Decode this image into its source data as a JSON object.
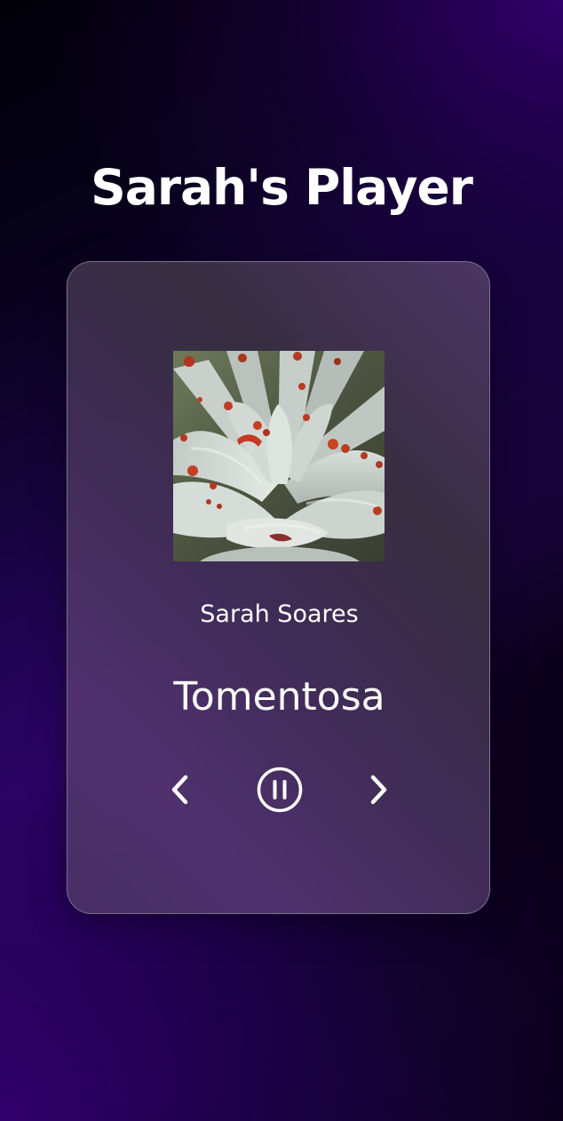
{
  "app": {
    "title": "Sarah's Player"
  },
  "track": {
    "artist": "Sarah Soares",
    "title": "Tomentosa",
    "artwork_icon": "succulent-album-art",
    "is_playing": true
  },
  "controls": {
    "previous_icon": "chevron-left-icon",
    "play_pause_icon": "pause-circle-icon",
    "next_icon": "chevron-right-icon"
  },
  "colors": {
    "background_dark": "#020009",
    "background_purple": "#2e0068",
    "card_tint": "#4a3862",
    "text": "#ffffff"
  }
}
